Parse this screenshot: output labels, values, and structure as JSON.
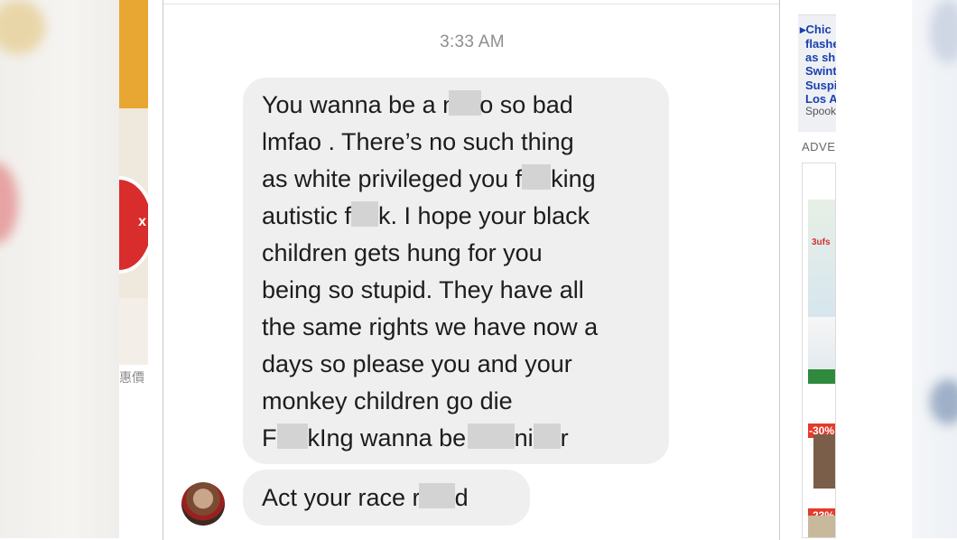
{
  "left": {
    "caption": "惠價",
    "ad_badge": "x"
  },
  "chat": {
    "timestamp": "3:33 AM",
    "message_main_lines": [
      [
        "You wanna be a n",
        "",
        "o so bad"
      ],
      [
        "lmfao . There’s no such thing"
      ],
      [
        "as white privileged you f",
        "",
        "king"
      ],
      [
        "autistic f",
        "",
        "k. I hope your black"
      ],
      [
        "children gets hung for you"
      ],
      [
        "being so stupid. They have all"
      ],
      [
        "the same rights we have now a"
      ],
      [
        "days so please you and your"
      ],
      [
        "monkey children go die"
      ],
      [
        "F",
        "",
        "kIng wanna be ",
        "",
        "ni",
        "",
        "r"
      ]
    ],
    "message_short": [
      "Act your race r",
      "",
      "d"
    ]
  },
  "sidebar": {
    "news": [
      "Chic",
      "flashe",
      "as sh",
      "Swint",
      "Suspi",
      "Los A"
    ],
    "news_meta": "Spook",
    "adv_label": "ADVERTISEMENT",
    "discounts": [
      "-30%",
      "-23%"
    ],
    "product_brand": "3ufs"
  },
  "colors": {
    "bubble_bg": "#efefef",
    "censor": "#d3d3d3",
    "news_link": "#1a3fb0",
    "discount_badge": "#e33b2c"
  }
}
